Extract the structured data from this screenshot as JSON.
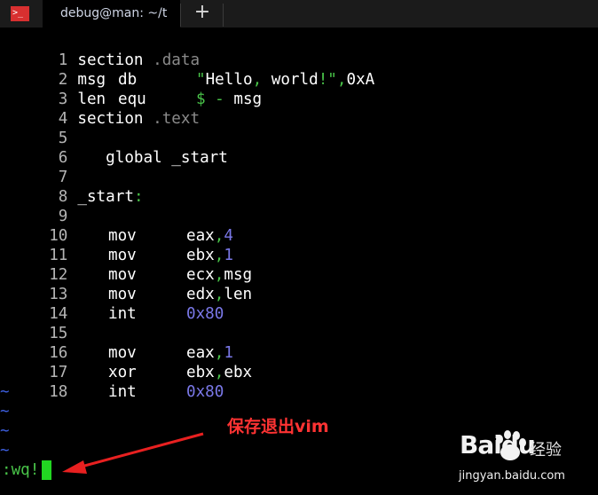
{
  "tab": {
    "icon": ">_",
    "title": "debug@man: ~/t",
    "new_tab": "+"
  },
  "code_lines": [
    {
      "n": "1",
      "c1": "section",
      "c2": ".data",
      "c3": ""
    },
    {
      "n": "2",
      "c1": "msg",
      "c2": "db",
      "c3": "\"Hello, world!\",0xA"
    },
    {
      "n": "3",
      "c1": "len",
      "c2": "equ",
      "c3": "$ - msg"
    },
    {
      "n": "4",
      "c1": "section",
      "c2": ".text",
      "c3": ""
    },
    {
      "n": "5",
      "c1": "",
      "c2": "",
      "c3": ""
    },
    {
      "n": "6",
      "c1": "   global _start",
      "c2": "",
      "c3": ""
    },
    {
      "n": "7",
      "c1": "",
      "c2": "",
      "c3": ""
    },
    {
      "n": "8",
      "c1": "_start:",
      "c2": "",
      "c3": ""
    },
    {
      "n": "9",
      "c1": "",
      "c2": "",
      "c3": ""
    },
    {
      "n": "10",
      "c1": "",
      "c2": "mov",
      "c3": "eax,4"
    },
    {
      "n": "11",
      "c1": "",
      "c2": "mov",
      "c3": "ebx,1"
    },
    {
      "n": "12",
      "c1": "",
      "c2": "mov",
      "c3": "ecx,msg"
    },
    {
      "n": "13",
      "c1": "",
      "c2": "mov",
      "c3": "edx,len"
    },
    {
      "n": "14",
      "c1": "",
      "c2": "int",
      "c3": "0x80"
    },
    {
      "n": "15",
      "c1": "",
      "c2": "",
      "c3": ""
    },
    {
      "n": "16",
      "c1": "",
      "c2": "mov",
      "c3": "eax,1"
    },
    {
      "n": "17",
      "c1": "",
      "c2": "xor",
      "c3": "ebx,ebx"
    },
    {
      "n": "18",
      "c1": "",
      "c2": "int",
      "c3": "0x80"
    }
  ],
  "tildes": [
    "~",
    "~",
    "~",
    "~"
  ],
  "command": ":wq!",
  "annotation": "保存退出vim",
  "watermark": {
    "logo": "Baidu",
    "label": "经验",
    "url": "jingyan.baidu.com"
  },
  "colors": {
    "background": "#000000",
    "string_green": "#49c449",
    "number_purple": "#7a78e8",
    "annotation_red": "#ff3333",
    "tilde_blue": "#3d5fe0"
  }
}
